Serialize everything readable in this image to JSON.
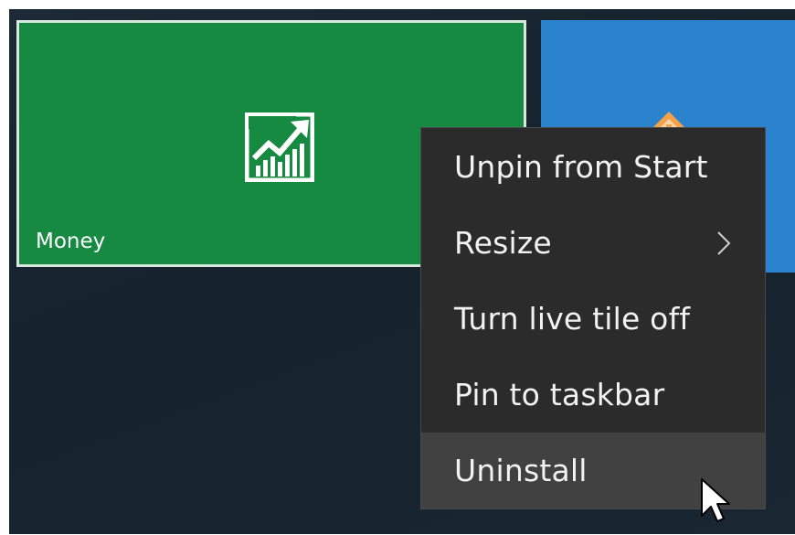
{
  "tiles": {
    "money": {
      "label": "Money",
      "icon": "chart-growth-icon",
      "color": "#168a40"
    },
    "partial": {
      "icon": "tile-app-icon",
      "color": "#2a83cc"
    }
  },
  "context_menu": {
    "items": [
      {
        "label": "Unpin from Start"
      },
      {
        "label": "Resize",
        "has_submenu": true,
        "submenu_icon": "chevron-right-icon"
      },
      {
        "label": "Turn live tile off"
      },
      {
        "label": "Pin to taskbar"
      },
      {
        "label": "Uninstall",
        "hovered": true
      }
    ]
  },
  "colors": {
    "start_background": "#1b2a36",
    "menu_background": "#2b2b2b",
    "menu_hover": "#414141"
  },
  "pointer": {
    "icon": "mouse-pointer-icon"
  }
}
